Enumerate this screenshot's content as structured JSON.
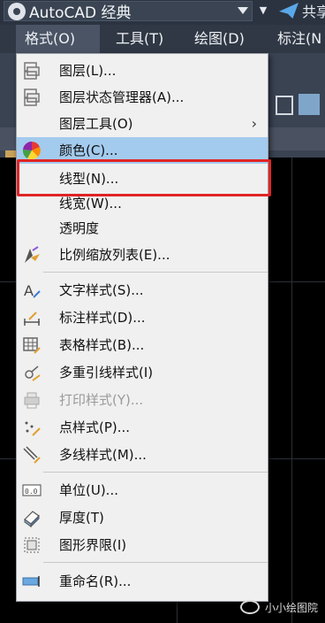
{
  "titlebar": {
    "workspace": "AutoCAD 经典",
    "share": "共享"
  },
  "menubar": {
    "items": [
      "格式(O)",
      "工具(T)",
      "绘图(D)",
      "标注(N"
    ]
  },
  "format_menu": {
    "items": [
      {
        "label": "图层(L)...",
        "icon": "layer-icon"
      },
      {
        "label": "图层状态管理器(A)...",
        "icon": "layer-state-icon"
      },
      {
        "label": "图层工具(O)",
        "icon": "",
        "submenu_arrow": "›"
      },
      {
        "label": "颜色(C)...",
        "icon": "color-wheel-icon"
      },
      {
        "label": "线型(N)...",
        "icon": ""
      },
      {
        "label": "线宽(W)...",
        "icon": ""
      },
      {
        "label": "透明度",
        "icon": ""
      },
      {
        "label": "比例缩放列表(E)...",
        "icon": "scale-list-icon"
      },
      {
        "label": "文字样式(S)...",
        "icon": "text-style-icon"
      },
      {
        "label": "标注样式(D)...",
        "icon": "dim-style-icon"
      },
      {
        "label": "表格样式(B)...",
        "icon": "table-style-icon"
      },
      {
        "label": "多重引线样式(I)",
        "icon": "mleader-style-icon"
      },
      {
        "label": "打印样式(Y)...",
        "icon": "plot-style-icon"
      },
      {
        "label": "点样式(P)...",
        "icon": "point-style-icon"
      },
      {
        "label": "多线样式(M)...",
        "icon": "mline-style-icon"
      },
      {
        "label": "单位(U)...",
        "icon": "units-icon"
      },
      {
        "label": "厚度(T)",
        "icon": "thickness-icon"
      },
      {
        "label": "图形界限(I)",
        "icon": "limits-icon"
      },
      {
        "label": "重命名(R)...",
        "icon": "rename-icon"
      }
    ]
  },
  "watermark": "小小绘图院",
  "colors": {
    "highlight": "#a3cbee",
    "annotation_box": "#e02424",
    "menubar": "#303845"
  }
}
